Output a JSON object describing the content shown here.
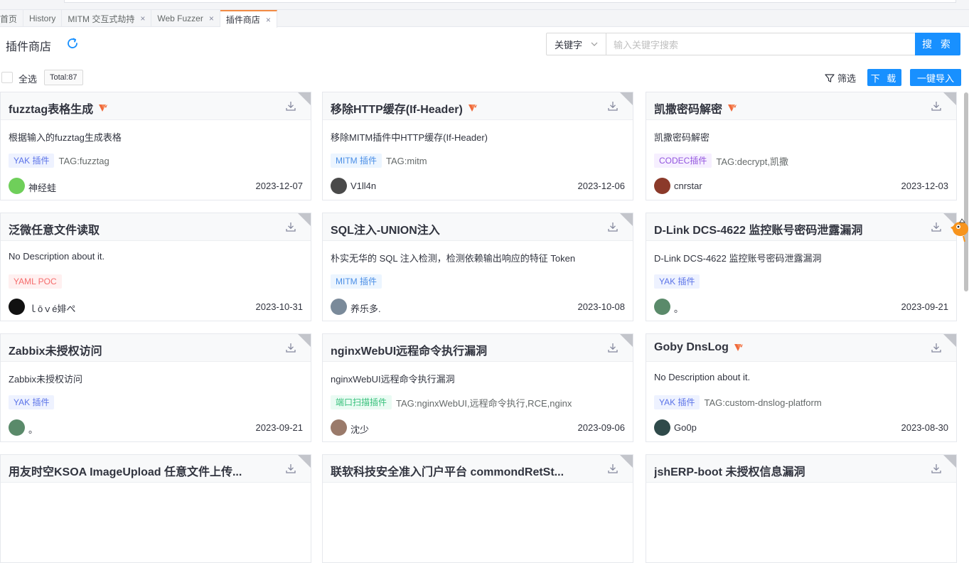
{
  "tabs": [
    {
      "label": "首页",
      "closable": false,
      "active": false
    },
    {
      "label": "History",
      "closable": false,
      "active": false
    },
    {
      "label": "MITM 交互式劫持",
      "closable": true,
      "active": false
    },
    {
      "label": "Web Fuzzer",
      "closable": true,
      "active": false
    },
    {
      "label": "插件商店",
      "closable": true,
      "active": true
    }
  ],
  "tab_close_glyph": "×",
  "header": {
    "title": "插件商店",
    "keyword_select": "关键字",
    "search_placeholder": "输入关键字搜索",
    "search_button": "搜 索"
  },
  "toolbar": {
    "select_all": "全选",
    "total": "Total:87",
    "filter": "筛选",
    "download": "下 载",
    "import_all": "一键导入"
  },
  "cards": [
    {
      "title": "fuzztag表格生成",
      "yak_badge": true,
      "desc": "根据输入的fuzztag生成表格",
      "tag_type": "YAK 插件",
      "tag_class": "tag-yak",
      "tags": "TAG:fuzztag",
      "author": "神经蛙",
      "date": "2023-12-07",
      "avatar_color": "#6fcf5a"
    },
    {
      "title": "移除HTTP缓存(If-Header)",
      "yak_badge": true,
      "desc": "移除MITM插件中HTTP缓存(If-Header)",
      "tag_type": "MITM 插件",
      "tag_class": "tag-mitm",
      "tags": "TAG:mitm",
      "author": "V1ll4n",
      "date": "2023-12-06",
      "avatar_color": "#4a4a4a"
    },
    {
      "title": "凯撒密码解密",
      "yak_badge": true,
      "desc": "凯撒密码解密",
      "tag_type": "CODEC插件",
      "tag_class": "tag-codec",
      "tags": "TAG:decrypt,凯撒",
      "author": "cnrstar",
      "date": "2023-12-03",
      "avatar_color": "#8b3a2a"
    },
    {
      "title": "泛微任意文件读取",
      "yak_badge": false,
      "desc": "No Description about it.",
      "tag_type": "YAML POC",
      "tag_class": "tag-yaml",
      "tags": "",
      "author": "ｌōｖé婔ぺ",
      "date": "2023-10-31",
      "avatar_color": "#111111"
    },
    {
      "title": "SQL注入-UNION注入",
      "yak_badge": false,
      "desc": "朴实无华的 SQL 注入检测，检测依赖输出响应的特征 Token",
      "tag_type": "MITM 插件",
      "tag_class": "tag-mitm",
      "tags": "",
      "author": "养乐多.",
      "date": "2023-10-08",
      "avatar_color": "#7a8a9a"
    },
    {
      "title": "D-Link DCS-4622 监控账号密码泄露漏洞",
      "yak_badge": false,
      "desc": "D-Link DCS-4622 监控账号密码泄露漏洞",
      "tag_type": "YAK 插件",
      "tag_class": "tag-yak",
      "tags": "",
      "author": "。",
      "date": "2023-09-21",
      "avatar_color": "#5a8a6a"
    },
    {
      "title": "Zabbix未授权访问",
      "yak_badge": false,
      "desc": "Zabbix未授权访问",
      "tag_type": "YAK 插件",
      "tag_class": "tag-yak",
      "tags": "",
      "author": "。",
      "date": "2023-09-21",
      "avatar_color": "#5a8a6a"
    },
    {
      "title": "nginxWebUI远程命令执行漏洞",
      "yak_badge": false,
      "desc": "nginxWebUI远程命令执行漏洞",
      "tag_type": "端口扫描插件",
      "tag_class": "tag-port",
      "tags": "TAG:nginxWebUI,远程命令执行,RCE,nginx",
      "author": "沈少",
      "date": "2023-09-06",
      "avatar_color": "#9a7a6a"
    },
    {
      "title": "Goby DnsLog",
      "yak_badge": true,
      "desc": "No Description about it.",
      "tag_type": "YAK 插件",
      "tag_class": "tag-yak",
      "tags": "TAG:custom-dnslog-platform",
      "author": "Go0p",
      "date": "2023-08-30",
      "avatar_color": "#2f4a4a"
    },
    {
      "title": "用友时空KSOA ImageUpload 任意文件上传...",
      "yak_badge": false,
      "desc": "",
      "tag_type": "",
      "tag_class": "",
      "tags": "",
      "author": "",
      "date": "",
      "avatar_color": ""
    },
    {
      "title": "联软科技安全准入门户平台 commondRetSt...",
      "yak_badge": false,
      "desc": "",
      "tag_type": "",
      "tag_class": "",
      "tags": "",
      "author": "",
      "date": "",
      "avatar_color": ""
    },
    {
      "title": "jshERP-boot 未授权信息漏洞",
      "yak_badge": false,
      "desc": "",
      "tag_type": "",
      "tag_class": "",
      "tags": "",
      "author": "",
      "date": "",
      "avatar_color": ""
    }
  ],
  "colors": {
    "accent": "#1890ff",
    "active_tab": "#f28b44",
    "yak_badge": "#f06a3b"
  },
  "icons": [
    "refresh-icon",
    "chevron-down-icon",
    "filter-icon",
    "download-icon",
    "yak-badge-icon",
    "close-icon"
  ]
}
